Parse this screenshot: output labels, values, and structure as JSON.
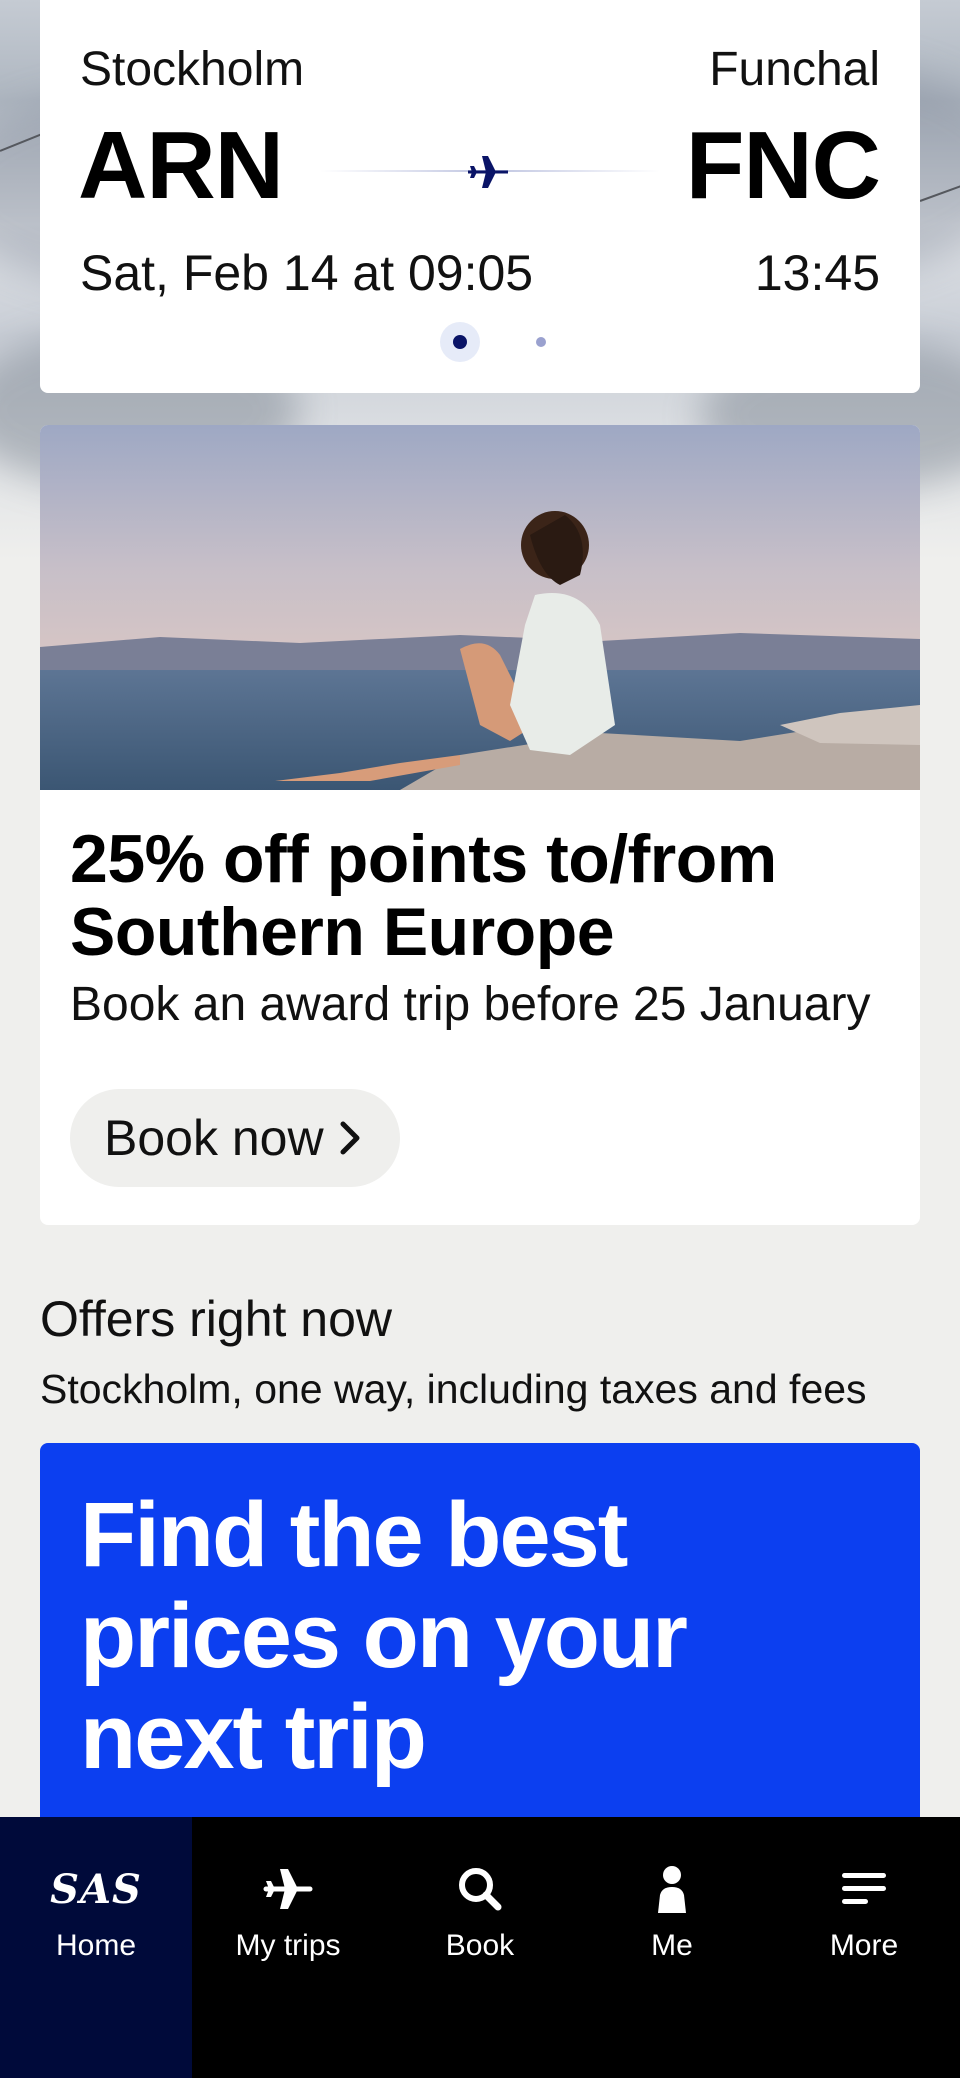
{
  "flight": {
    "from_city": "Stockholm",
    "to_city": "Funchal",
    "from_code": "ARN",
    "to_code": "FNC",
    "departure": "Sat, Feb 14 at 09:05",
    "arrival": "13:45",
    "pager": {
      "pages": 2,
      "active": 1
    }
  },
  "promo": {
    "title": "25% off points to/from Southern Europe",
    "subtitle": "Book an award trip before 25 January",
    "button_label": "Book now"
  },
  "offers": {
    "title": "Offers right now",
    "subtitle": "Stockholm, one way, including taxes and fees",
    "banner_headline": "Find the best prices on your next trip"
  },
  "nav": {
    "items": [
      {
        "label": "Home",
        "icon": "sas-logo-icon",
        "logo_text": "SAS",
        "active": true
      },
      {
        "label": "My trips",
        "icon": "airplane-icon"
      },
      {
        "label": "Book",
        "icon": "search-icon"
      },
      {
        "label": "Me",
        "icon": "person-icon"
      },
      {
        "label": "More",
        "icon": "menu-icon"
      }
    ]
  },
  "colors": {
    "brand_navy": "#000a3a",
    "banner_blue": "#0c3ff0",
    "accent_dark_blue": "#0a1467",
    "page_bg": "#efefed"
  }
}
